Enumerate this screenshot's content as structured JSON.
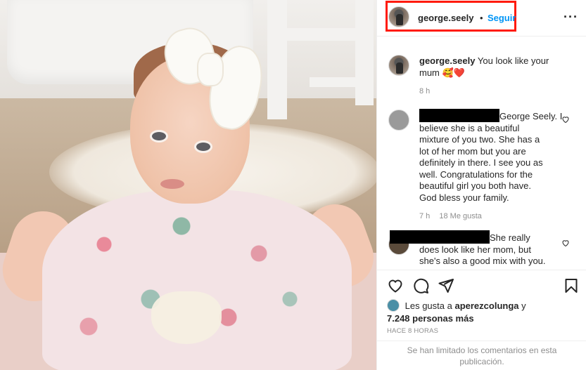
{
  "post": {
    "photo_alt": "baby-photo"
  },
  "header": {
    "username": "george.seely",
    "separator": "•",
    "follow_label": "Seguir",
    "menu_glyph": "···"
  },
  "comments": {
    "caption": {
      "username": "george.seely",
      "text": "You look like your mum",
      "emoji": "🥰❤️",
      "time": "8 h"
    },
    "items": [
      {
        "text_after_redaction": "George Seely. I",
        "lines": [
          "believe she is a beautiful",
          "mixture of you two. She has a",
          "lot of her mom but you are",
          "definitely in there. I see you as",
          "well. Congratulations for the",
          "beautiful girl you both have.",
          "God bless your family."
        ],
        "time": "7 h",
        "likes": "18 Me gusta"
      },
      {
        "text_after_redaction": "She really",
        "lines": [
          "does look like her mom, but",
          "she's also a good mix with you."
        ]
      }
    ]
  },
  "actions": {
    "icons": [
      "heart-icon",
      "comment-icon",
      "share-icon",
      "bookmark-icon"
    ]
  },
  "likes": {
    "prefix": "Les gusta a",
    "user": "aperezcolunga",
    "mid": "y",
    "count": "7.248 personas más"
  },
  "timestamp": "HACE 8 HORAS",
  "limited_notice": "Se han limitado los comentarios en esta publicación.",
  "colors": {
    "accent": "#0095f6",
    "highlight": "#ff1a0a",
    "muted": "#8e8e8e"
  }
}
